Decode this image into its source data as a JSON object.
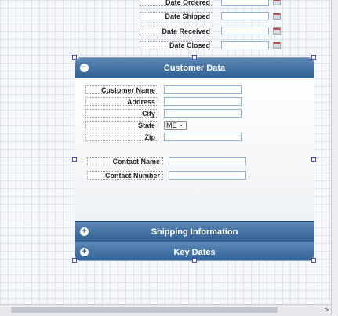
{
  "top_fields": [
    {
      "label": "Date Ordered"
    },
    {
      "label": "Date Shipped"
    },
    {
      "label": "Date Received"
    },
    {
      "label": "Date Closed"
    }
  ],
  "panel": {
    "customer_header": "Customer Data",
    "customer_icon": "minus-icon",
    "fields": {
      "customer_name": "Customer Name",
      "address": "Address",
      "city": "City",
      "state": "State",
      "zip": "Zip",
      "contact_name": "Contact Name",
      "contact_number": "Contact Number"
    },
    "state_value": "ME",
    "shipping_header": "Shipping Information",
    "shipping_icon": "plus-icon",
    "keydates_header": "Key Dates",
    "keydates_icon": "plus-icon"
  },
  "scroll": {
    "right_arrow": ">"
  },
  "colors": {
    "header_top": "#5b87b6",
    "header_bottom": "#2f5f92",
    "field_border": "#8eb3d6"
  }
}
